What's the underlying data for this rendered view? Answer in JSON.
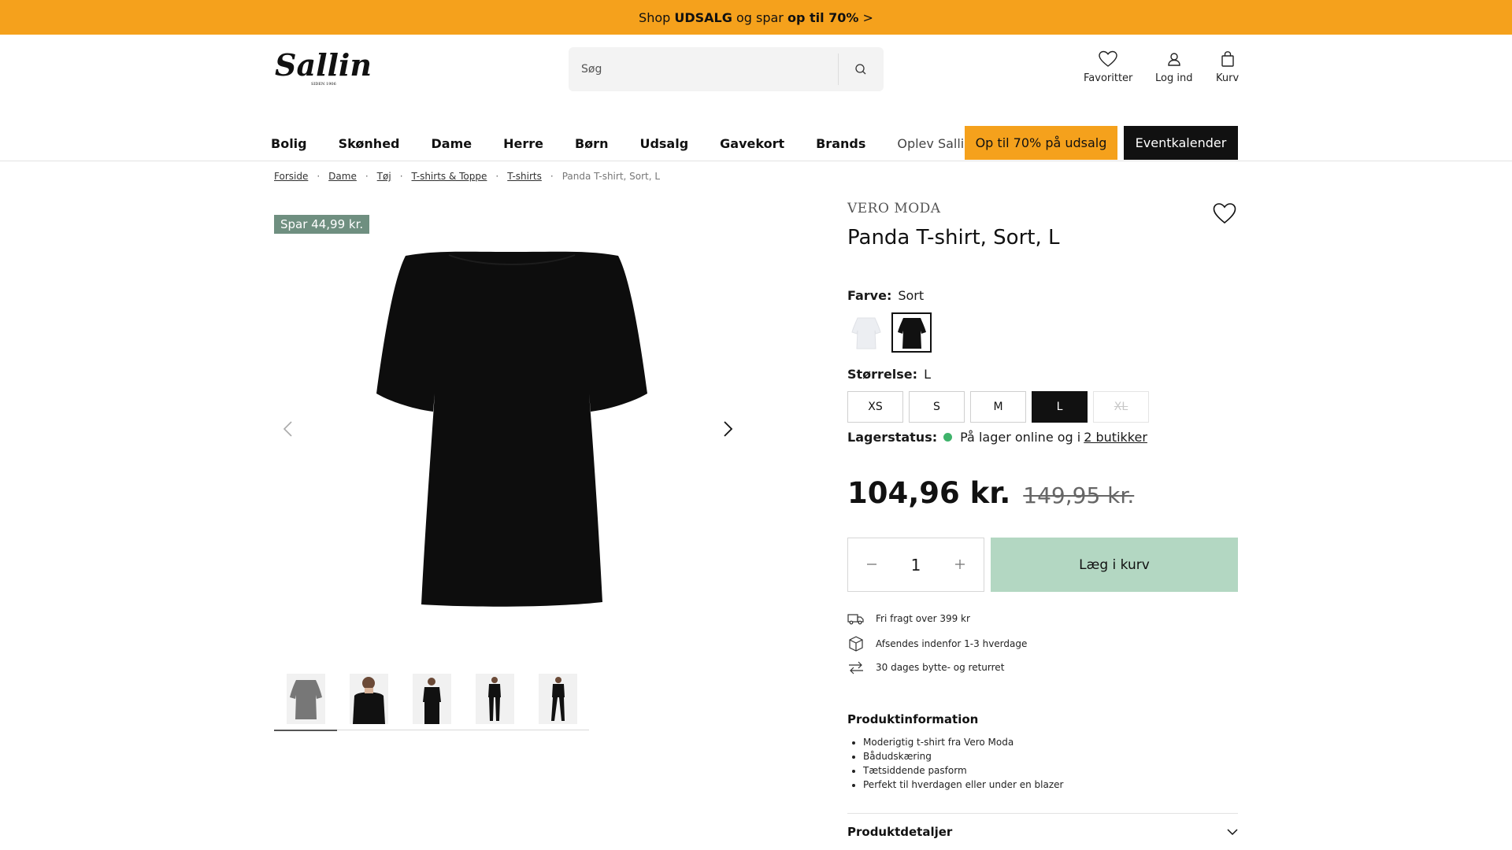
{
  "promo": {
    "part1": "Shop ",
    "part2": "UDSALG",
    "part3": " og spar ",
    "part4": "op til 70%",
    "part5": " >"
  },
  "header": {
    "logo_text": "Salling",
    "logo_sub": "SIDEN 1906",
    "search_placeholder": "Søg",
    "favorites_label": "Favoritter",
    "login_label": "Log ind",
    "cart_label": "Kurv"
  },
  "nav": {
    "items": [
      "Bolig",
      "Skønhed",
      "Dame",
      "Herre",
      "Børn",
      "Udsalg",
      "Gavekort",
      "Brands",
      "Oplev Salling"
    ],
    "sale_button": "Op til 70% på udsalg",
    "event_button": "Eventkalender"
  },
  "breadcrumb": {
    "items": [
      "Forside",
      "Dame",
      "Tøj",
      "T-shirts & Toppe",
      "T-shirts"
    ],
    "current": "Panda T-shirt, Sort, L"
  },
  "gallery": {
    "save_badge": "Spar 44,99 kr."
  },
  "product": {
    "brand": "VERO MODA",
    "title": "Panda T-shirt, Sort, L",
    "color_label": "Farve:",
    "color_value": "Sort",
    "size_label": "Størrelse:",
    "size_value": "L",
    "sizes": [
      "XS",
      "S",
      "M",
      "L",
      "XL"
    ],
    "stock_label": "Lagerstatus:",
    "stock_text": "På lager online og i",
    "stock_link": "2 butikker",
    "price_now": "104,96 kr.",
    "price_old": "149,95 kr.",
    "quantity": "1",
    "add_to_cart": "Læg i kurv",
    "usps": [
      "Fri fragt over 399 kr",
      "Afsendes indenfor 1-3 hverdage",
      "30 dages bytte- og returret"
    ],
    "info_title": "Produktinformation",
    "info_items": [
      "Moderigtig t-shirt fra Vero Moda",
      "Bådudskæring",
      "Tætsiddende pasform",
      "Perfekt til hverdagen eller under en blazer"
    ],
    "details_title": "Produktdetaljer"
  },
  "colors": {
    "promo": "#f5a11c",
    "add_to_cart": "#b3d7c2",
    "badge": "#6f8f80",
    "in_stock": "#3fb36b"
  }
}
